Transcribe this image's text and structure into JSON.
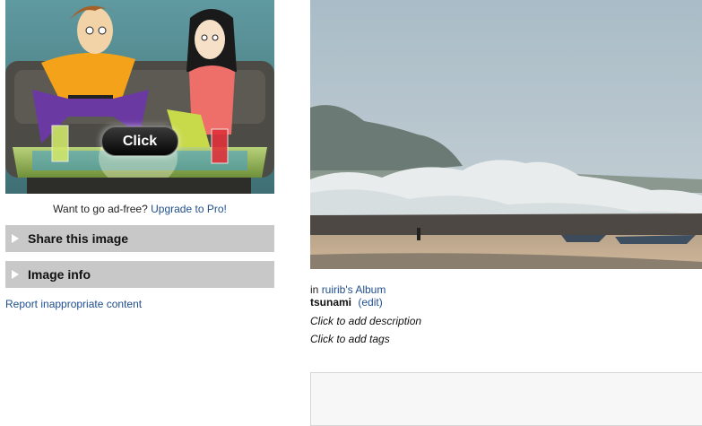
{
  "ad": {
    "button_label": "Click",
    "ad_free_text": "Want to go ad-free?",
    "upgrade_link": "Upgrade to Pro!"
  },
  "sections": {
    "share_label": "Share this image",
    "info_label": "Image info"
  },
  "report_link": "Report inappropriate content",
  "photo": {
    "album_prefix": "in",
    "album_link": "ruirib's Album",
    "title": "tsunami",
    "edit_link": "(edit)",
    "description_placeholder": "Click to add description",
    "tags_placeholder": "Click to add tags"
  },
  "icons": {
    "section_toggle": "triangle-right-icon"
  },
  "colors": {
    "link": "#1f4e8c",
    "section_bar": "#c8c8c8"
  }
}
